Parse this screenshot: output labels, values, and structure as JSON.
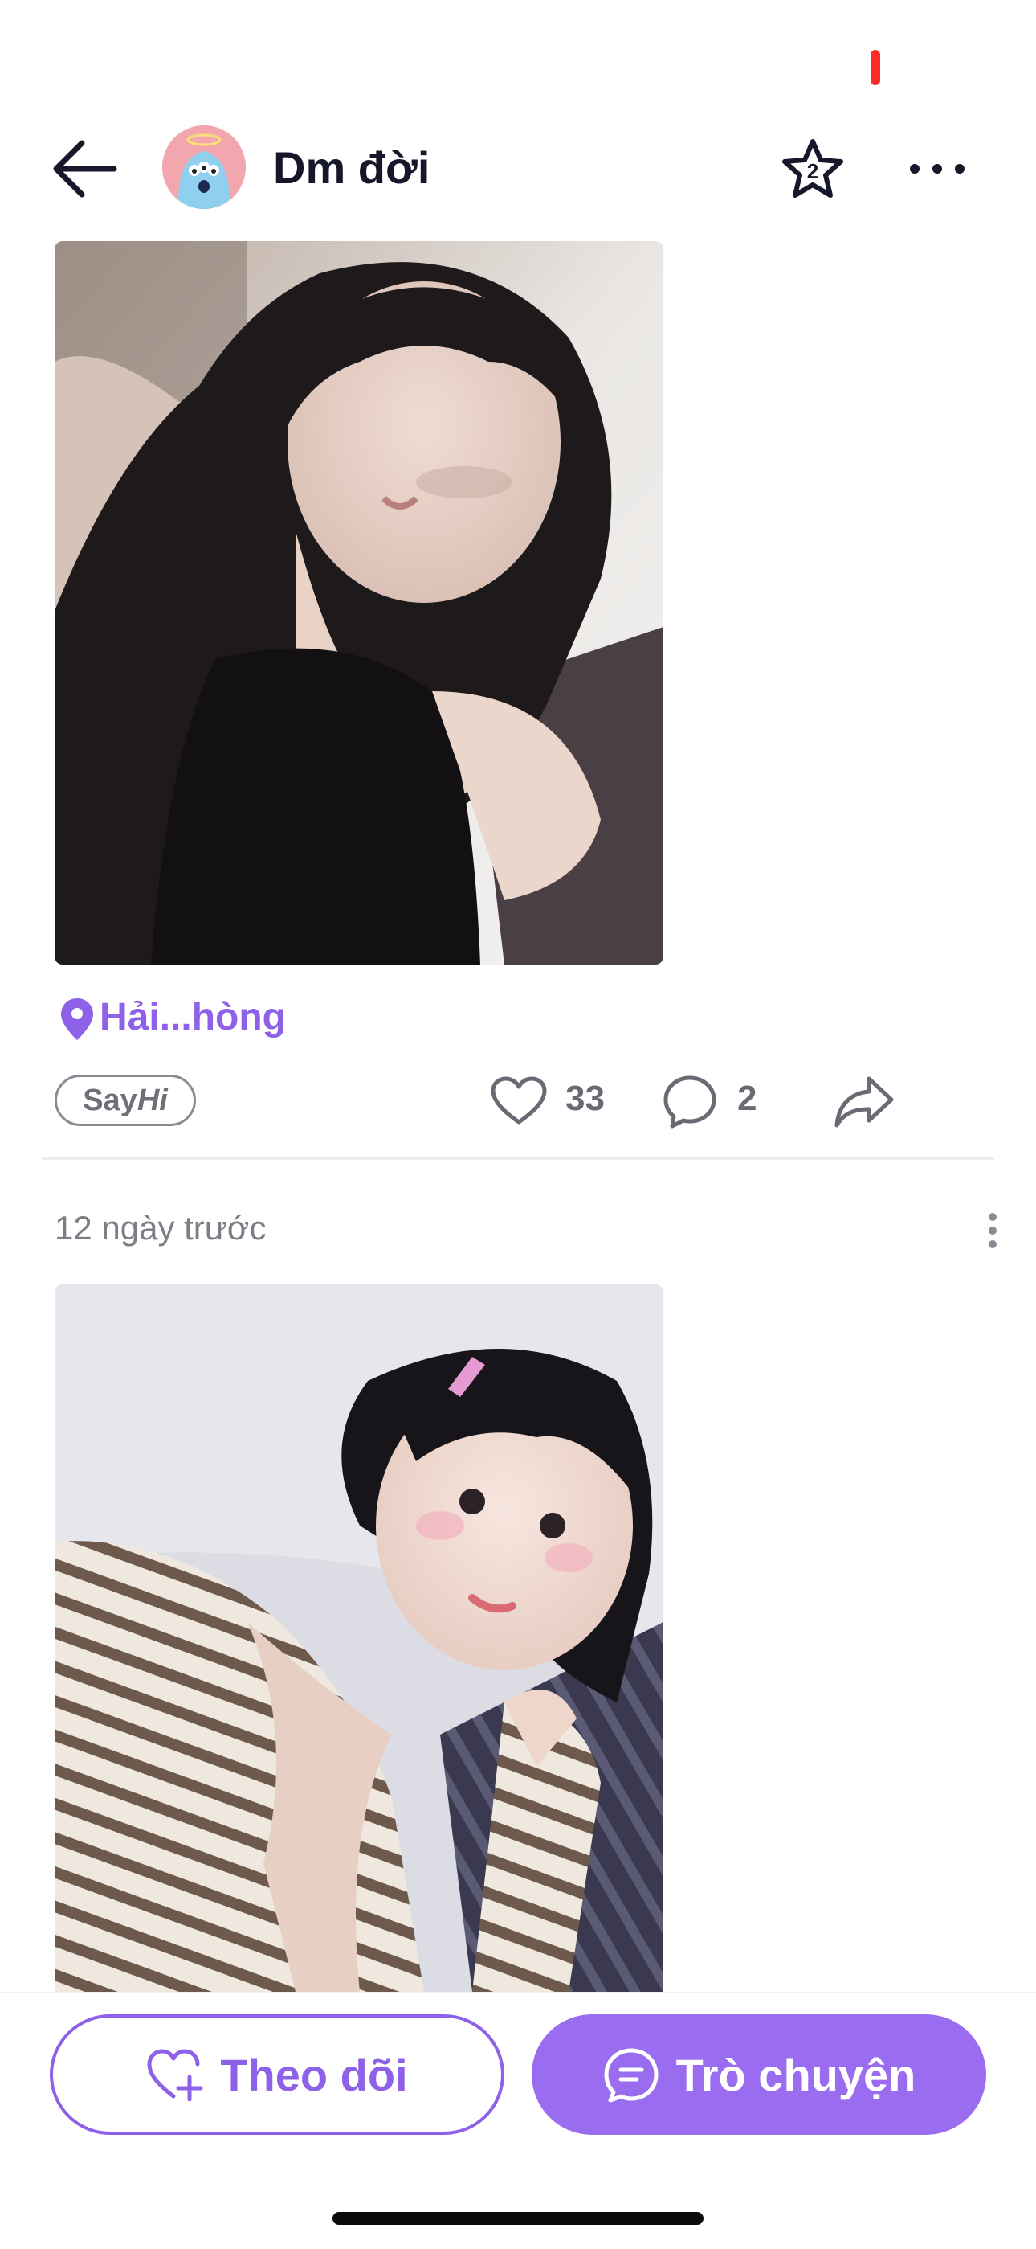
{
  "header": {
    "title": "Dm đời",
    "star_badge": "2",
    "icons": [
      "back-arrow-icon",
      "star-icon",
      "more-horizontal-icon"
    ]
  },
  "post1": {
    "location": "Hải...hòng",
    "sayhi": {
      "say": "Say",
      "hi": "Hi"
    },
    "likes": "33",
    "comments": "2"
  },
  "post2": {
    "time_ago": "12 ngày trước"
  },
  "bottom": {
    "follow_label": "Theo dõi",
    "chat_label": "Trò chuyện"
  },
  "colors": {
    "accent": "#8e62e8",
    "accent_fill": "#9a6cf0",
    "avatar_bg": "#f2a6ad",
    "text_muted": "#6a6a74"
  }
}
